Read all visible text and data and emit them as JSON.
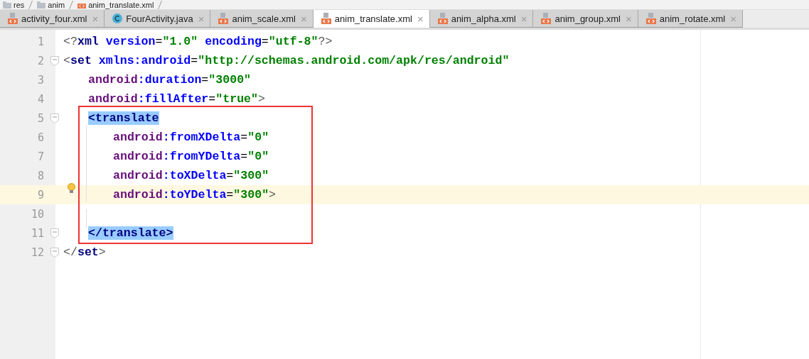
{
  "breadcrumb": [
    {
      "label": "res"
    },
    {
      "label": "anim"
    },
    {
      "label": "anim_translate.xml"
    }
  ],
  "tabs": [
    {
      "label": "activity_four.xml",
      "close": "×",
      "selected": false
    },
    {
      "label": "FourActivity.java",
      "close": "×",
      "selected": false
    },
    {
      "label": "anim_scale.xml",
      "close": "×",
      "selected": false
    },
    {
      "label": "anim_translate.xml",
      "close": "×",
      "selected": true
    },
    {
      "label": "anim_alpha.xml",
      "close": "×",
      "selected": false
    },
    {
      "label": "anim_group.xml",
      "close": "×",
      "selected": false
    },
    {
      "label": "anim_rotate.xml",
      "close": "×",
      "selected": false
    }
  ],
  "editor": {
    "frame_shown": true,
    "lines": [
      {
        "number": "1",
        "fold": false,
        "current": false,
        "bulb": false,
        "tokens": [
          {
            "kind": "punct",
            "text": "<?"
          },
          {
            "kind": "tag",
            "text": "xml"
          },
          {
            "kind": "attr",
            "text": " version"
          },
          {
            "kind": "plain",
            "text": "="
          },
          {
            "kind": "value",
            "text": "\"1.0\""
          },
          {
            "kind": "attr",
            "text": " encoding"
          },
          {
            "kind": "plain",
            "text": "="
          },
          {
            "kind": "value",
            "text": "\"utf-8\""
          },
          {
            "kind": "punct",
            "text": "?>"
          }
        ]
      },
      {
        "number": "2",
        "fold": true,
        "current": false,
        "bulb": false,
        "tokens": [
          {
            "kind": "punct",
            "text": "<"
          },
          {
            "kind": "tag",
            "text": "set"
          },
          {
            "kind": "attr",
            "text": " xmlns:android"
          },
          {
            "kind": "plain",
            "text": "="
          },
          {
            "kind": "value",
            "text": "\"http://schemas.android.com/apk/res/android\""
          }
        ],
        "children": [
          {
            "number": "3",
            "fold": false,
            "current": false,
            "bulb": false,
            "tokens": [
              {
                "kind": "ns",
                "text": "android"
              },
              {
                "kind": "attr",
                "text": ":duration"
              },
              {
                "kind": "plain",
                "text": "="
              },
              {
                "kind": "value",
                "text": "\"3000\""
              }
            ]
          },
          {
            "number": "4",
            "fold": false,
            "current": false,
            "bulb": false,
            "tokens": [
              {
                "kind": "ns",
                "text": "android"
              },
              {
                "kind": "attr",
                "text": ":fillAfter"
              },
              {
                "kind": "plain",
                "text": "="
              },
              {
                "kind": "value",
                "text": "\"true\""
              },
              {
                "kind": "punct",
                "text": ">"
              }
            ]
          },
          {
            "number": "5",
            "fold": true,
            "current": false,
            "bulb": false,
            "tokens": [
              {
                "kind": "match",
                "text": "<translate"
              }
            ],
            "children": [
              {
                "number": "6",
                "fold": false,
                "current": false,
                "bulb": false,
                "tokens": [
                  {
                    "kind": "ns",
                    "text": "android"
                  },
                  {
                    "kind": "attr",
                    "text": ":fromXDelta"
                  },
                  {
                    "kind": "plain",
                    "text": "="
                  },
                  {
                    "kind": "value",
                    "text": "\"0\""
                  }
                ]
              },
              {
                "number": "7",
                "fold": false,
                "current": false,
                "bulb": false,
                "tokens": [
                  {
                    "kind": "ns",
                    "text": "android"
                  },
                  {
                    "kind": "attr",
                    "text": ":fromYDelta"
                  },
                  {
                    "kind": "plain",
                    "text": "="
                  },
                  {
                    "kind": "value",
                    "text": "\"0\""
                  }
                ]
              },
              {
                "number": "8",
                "fold": false,
                "current": false,
                "bulb": false,
                "tokens": [
                  {
                    "kind": "ns",
                    "text": "android"
                  },
                  {
                    "kind": "attr",
                    "text": ":toXDelta"
                  },
                  {
                    "kind": "plain",
                    "text": "="
                  },
                  {
                    "kind": "value",
                    "text": "\"300\""
                  }
                ]
              },
              {
                "number": "9",
                "fold": false,
                "current": true,
                "bulb": true,
                "tokens": [
                  {
                    "kind": "ns",
                    "text": "android"
                  },
                  {
                    "kind": "attr",
                    "text": ":toYDelta"
                  },
                  {
                    "kind": "plain",
                    "text": "="
                  },
                  {
                    "kind": "value",
                    "text": "\"300\""
                  },
                  {
                    "kind": "punct",
                    "text": ">"
                  }
                ]
              },
              {
                "number": "10",
                "fold": false,
                "current": false,
                "bulb": false
              }
            ]
          },
          {
            "number": "11",
            "fold": true,
            "current": false,
            "bulb": false,
            "tokens": [
              {
                "kind": "match",
                "text": "</translate>"
              }
            ]
          }
        ]
      },
      {
        "number": "12",
        "fold": true,
        "current": false,
        "bulb": false,
        "tokens": [
          {
            "kind": "punct",
            "text": "</"
          },
          {
            "kind": "tag",
            "text": "set"
          },
          {
            "kind": "punct",
            "text": ">"
          }
        ]
      }
    ]
  }
}
